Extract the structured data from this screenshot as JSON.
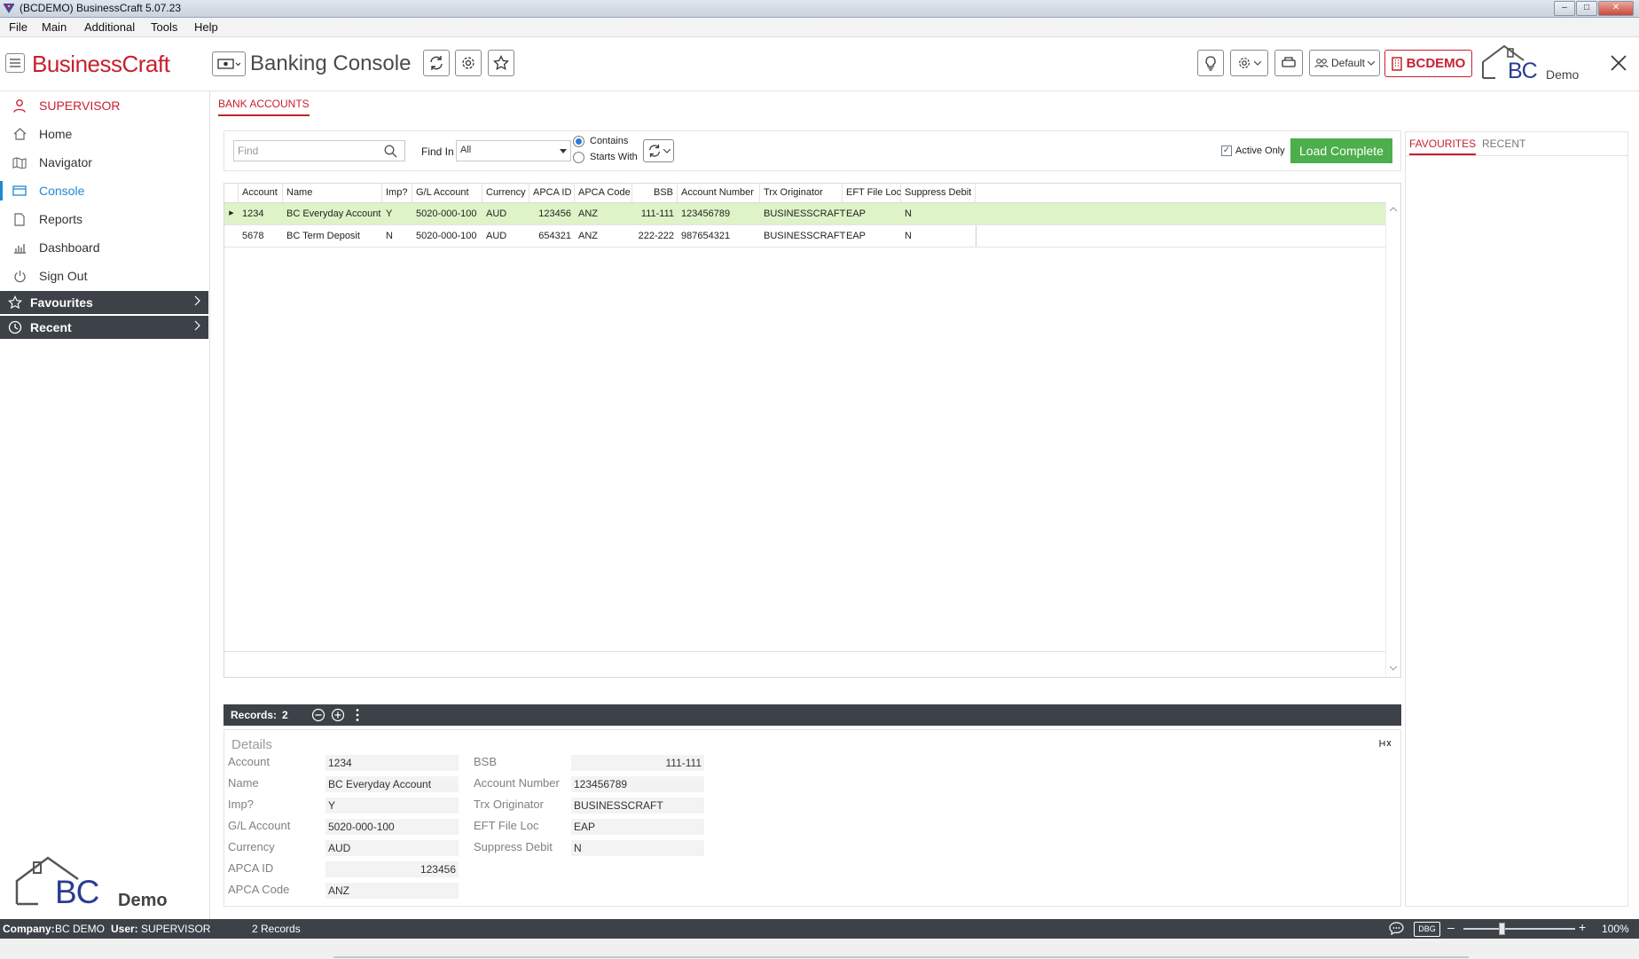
{
  "window": {
    "title": "(BCDEMO) BusinessCraft  5.07.23"
  },
  "menubar": {
    "items": [
      "File",
      "Main",
      "Additional",
      "Tools",
      "Help"
    ]
  },
  "header": {
    "brand": "BusinessCraft",
    "console_title": "Banking Console",
    "profile_label": "Default",
    "company_button": "BCDEMO",
    "logo_letters": "BC",
    "logo_caption": "Demo"
  },
  "sidebar": {
    "user": "SUPERVISOR",
    "items": [
      {
        "label": "Home",
        "icon": "home-icon"
      },
      {
        "label": "Navigator",
        "icon": "map-icon"
      },
      {
        "label": "Console",
        "icon": "console-icon",
        "active": true
      },
      {
        "label": "Reports",
        "icon": "document-icon"
      },
      {
        "label": "Dashboard",
        "icon": "bar-chart-icon"
      },
      {
        "label": "Sign Out",
        "icon": "power-icon"
      }
    ],
    "sections": [
      "Favourites",
      "Recent"
    ],
    "footer_logo_letters": "BC",
    "footer_caption": "Demo"
  },
  "main": {
    "tab": "BANK ACCOUNTS",
    "find": {
      "placeholder": "Find",
      "find_in_label": "Find In",
      "find_in_value": "All"
    },
    "match_options": [
      "Contains",
      "Starts With"
    ],
    "match_selected": "Contains",
    "active_only_label": "Active Only",
    "active_only_checked": true,
    "load_button": "Load Complete"
  },
  "grid": {
    "columns": [
      "Account",
      "Name",
      "Imp?",
      "G/L Account",
      "Currency",
      "APCA ID",
      "APCA Code",
      "BSB",
      "Account Number",
      "Trx Originator",
      "EFT File Loc",
      "Suppress Debit"
    ],
    "rows": [
      [
        "1234",
        "BC Everyday Account",
        "Y",
        "5020-000-100",
        "AUD",
        "123456",
        "ANZ",
        "111-111",
        "123456789",
        "BUSINESSCRAFT",
        "EAP",
        "N"
      ],
      [
        "5678",
        "BC Term Deposit",
        "N",
        "5020-000-100",
        "AUD",
        "654321",
        "ANZ",
        "222-222",
        "987654321",
        "BUSINESSCRAFT",
        "EAP",
        "N"
      ]
    ],
    "selected_row": 0
  },
  "records_bar": {
    "label": "Records:",
    "count": "2"
  },
  "details": {
    "title": "Details",
    "left": [
      {
        "label": "Account",
        "value": "1234"
      },
      {
        "label": "Name",
        "value": "BC Everyday Account"
      },
      {
        "label": "Imp?",
        "value": "Y"
      },
      {
        "label": "G/L Account",
        "value": "5020-000-100"
      },
      {
        "label": "Currency",
        "value": "AUD"
      },
      {
        "label": "APCA ID",
        "value": "123456"
      },
      {
        "label": "APCA Code",
        "value": "ANZ"
      }
    ],
    "right": [
      {
        "label": "BSB",
        "value": "111-111"
      },
      {
        "label": "Account Number",
        "value": "123456789"
      },
      {
        "label": "Trx Originator",
        "value": "BUSINESSCRAFT"
      },
      {
        "label": "EFT File Loc",
        "value": "EAP"
      },
      {
        "label": "Suppress Debit",
        "value": "N"
      }
    ]
  },
  "right_panel": {
    "tabs": [
      "FAVOURITES",
      "RECENT"
    ],
    "active_tab": "FAVOURITES"
  },
  "status": {
    "company_label": "Company:",
    "company": "BC DEMO",
    "user_label": "User:",
    "user": "SUPERVISOR",
    "records": "2 Records",
    "dbg": "DBG",
    "zoom": "100%"
  },
  "colors": {
    "brand_red": "#c8202f",
    "accent_blue": "#1f8ad0",
    "sidebar_dark": "#3c4248",
    "load_green": "#4cae4c",
    "row_selected": "#dff3c8"
  }
}
